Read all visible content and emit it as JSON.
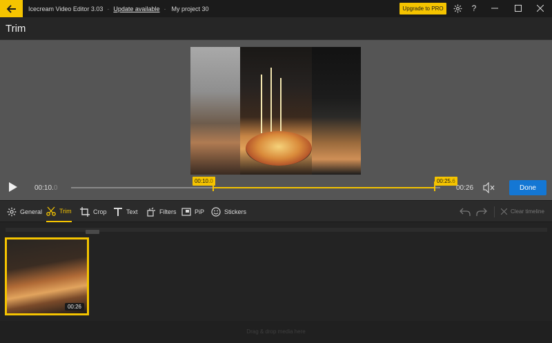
{
  "titlebar": {
    "app_name": "Icecream Video Editor 3.03",
    "separator": "·",
    "update_link": "Update available",
    "project_name": "My project 30",
    "upgrade_label": "Upgrade to PRO",
    "help_label": "?",
    "accent": "#f5c400"
  },
  "header": {
    "title": "Trim"
  },
  "player": {
    "current_time_main": "00:10.",
    "current_time_frac": "0",
    "trim_start_main": "00:10.",
    "trim_start_frac": "0",
    "trim_end_main": "00:25.",
    "trim_end_frac": "6",
    "duration": "00:26",
    "done_label": "Done",
    "trim_start_fraction": 0.385,
    "trim_end_fraction": 0.985
  },
  "toolbar": {
    "tools": [
      {
        "label": "General",
        "icon": "gear-icon"
      },
      {
        "label": "Trim",
        "icon": "scissors-icon",
        "active": true
      },
      {
        "label": "Crop",
        "icon": "crop-icon"
      },
      {
        "label": "Text",
        "icon": "text-icon"
      },
      {
        "label": "Filters",
        "icon": "filters-icon"
      },
      {
        "label": "PiP",
        "icon": "pip-icon"
      },
      {
        "label": "Stickers",
        "icon": "sticker-icon"
      }
    ],
    "clear_label": "Clear timeline"
  },
  "timeline": {
    "clip_duration": "00:26",
    "drop_hint": "Drag & drop media here"
  }
}
